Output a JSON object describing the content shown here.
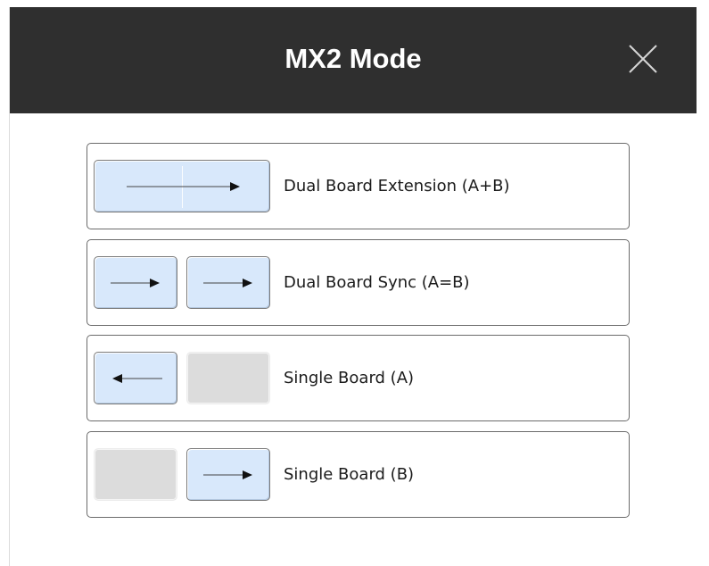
{
  "dialog": {
    "title": "MX2 Mode",
    "close_icon": "close-icon"
  },
  "options": [
    {
      "label": "Dual Board Extension (A+B)",
      "boards": "A+B extended",
      "icon": "right-arrow-icon"
    },
    {
      "label": "Dual Board Sync (A=B)",
      "boards": "A and B synced",
      "icon": "right-arrow-icon"
    },
    {
      "label": "Single Board (A)",
      "boards": "A active, B inactive",
      "icon": "left-arrow-icon"
    },
    {
      "label": "Single Board (B)",
      "boards": "A inactive, B active",
      "icon": "right-arrow-icon"
    }
  ],
  "colors": {
    "titlebar": "#2f2f2f",
    "board_active": "#d8e8fb",
    "board_inactive": "#dcdcdc",
    "option_border": "#6b6b6b"
  }
}
